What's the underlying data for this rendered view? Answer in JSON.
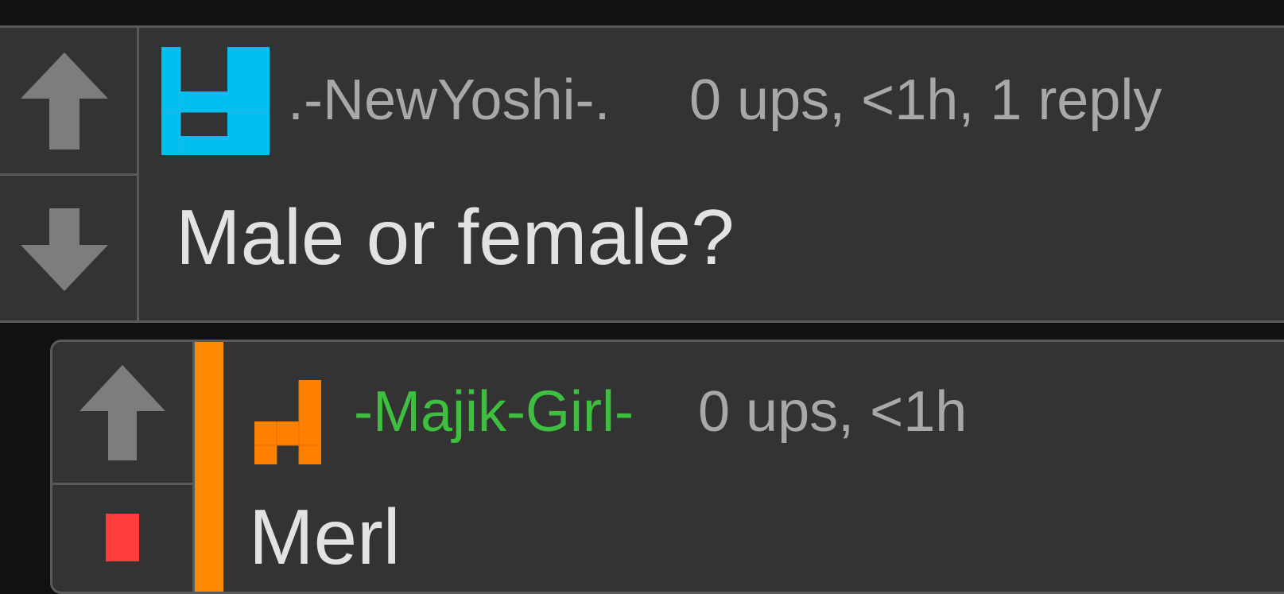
{
  "comments": [
    {
      "author": ".-NewYoshi-.",
      "meta": "0 ups, <1h, 1 reply",
      "body": "Male or female?",
      "author_color": "#a8a8a8",
      "avatar_color": "#00c0f0",
      "avatar_icon": "blue-glyph-avatar"
    },
    {
      "author": "-Majik-Girl-",
      "meta": "0 ups, <1h",
      "body": "Merl",
      "author_color": "#3fbf3f",
      "avatar_color": "#ff8000",
      "avatar_icon": "orange-glyph-avatar",
      "reply_bar_color": "#ff8a00"
    }
  ],
  "colors": {
    "background": "#111111",
    "panel": "#333333",
    "border": "#5a5a5a",
    "arrow": "#7d7d7d",
    "downvote_active": "#ff3c3c"
  }
}
